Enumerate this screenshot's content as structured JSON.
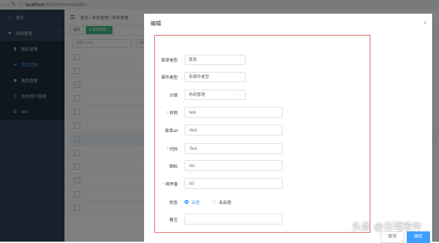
{
  "browser": {
    "url_host": "localhost",
    "url_rest": ":9527/#/menu/index"
  },
  "sidebar": {
    "items": [
      {
        "icon": "home-icon",
        "glyph": "⌂",
        "label": "首页"
      },
      {
        "icon": "lock-icon",
        "glyph": "🔒",
        "label": "系统管理"
      },
      {
        "icon": "icon-mgmt-icon",
        "glyph": "▮",
        "label": "图标管理"
      },
      {
        "icon": "menu-mgmt-icon",
        "glyph": "▰",
        "label": "菜单管理"
      },
      {
        "icon": "user-icon",
        "glyph": "👤",
        "label": "角色管理"
      },
      {
        "icon": "admin-user-icon",
        "glyph": "▯",
        "label": "后台用户管理"
      },
      {
        "icon": "list-icon",
        "glyph": "☰",
        "label": "test"
      }
    ]
  },
  "header": {
    "breadcrumb": "首页 / 系统管理 / 菜单管理"
  },
  "tabs": [
    {
      "label": "首页"
    },
    {
      "label": "● 菜单管理 ×"
    }
  ],
  "search": {
    "placeholder1": "请输入内容",
    "placeholder2": "类型"
  },
  "table": {
    "header": "名称",
    "rows": [
      "分页api",
      "编辑",
      "查看",
      "删除",
      "新增",
      "test",
      "分配角色",
      "分页api",
      "编辑",
      "查看",
      "删除"
    ]
  },
  "dialog": {
    "title": "编辑",
    "close": "×",
    "fields": {
      "menu_type": {
        "label": "菜单类型",
        "value": "菜单"
      },
      "op_type": {
        "label": "操作类型",
        "value": "非操作类型"
      },
      "parent": {
        "label": "父级",
        "value": "系统管理"
      },
      "name": {
        "label": "名称",
        "value": "test"
      },
      "url": {
        "label": "菜单url",
        "value": "/test"
      },
      "code": {
        "label": "代码",
        "value": "Test"
      },
      "icon": {
        "label": "图标",
        "value": "list"
      },
      "sort": {
        "label": "排序值",
        "value": "50"
      },
      "status": {
        "label": "状态",
        "options": [
          "启用",
          "未启用"
        ],
        "selected": "启用"
      },
      "remark": {
        "label": "备注",
        "value": ""
      }
    },
    "buttons": {
      "cancel": "取消",
      "ok": "确定"
    }
  },
  "watermark": "头条 @云珺软件",
  "colors": {
    "sidebar_bg": "#304156",
    "accent": "#409eff",
    "required": "#f56c6c",
    "form_border": "#e06666"
  }
}
